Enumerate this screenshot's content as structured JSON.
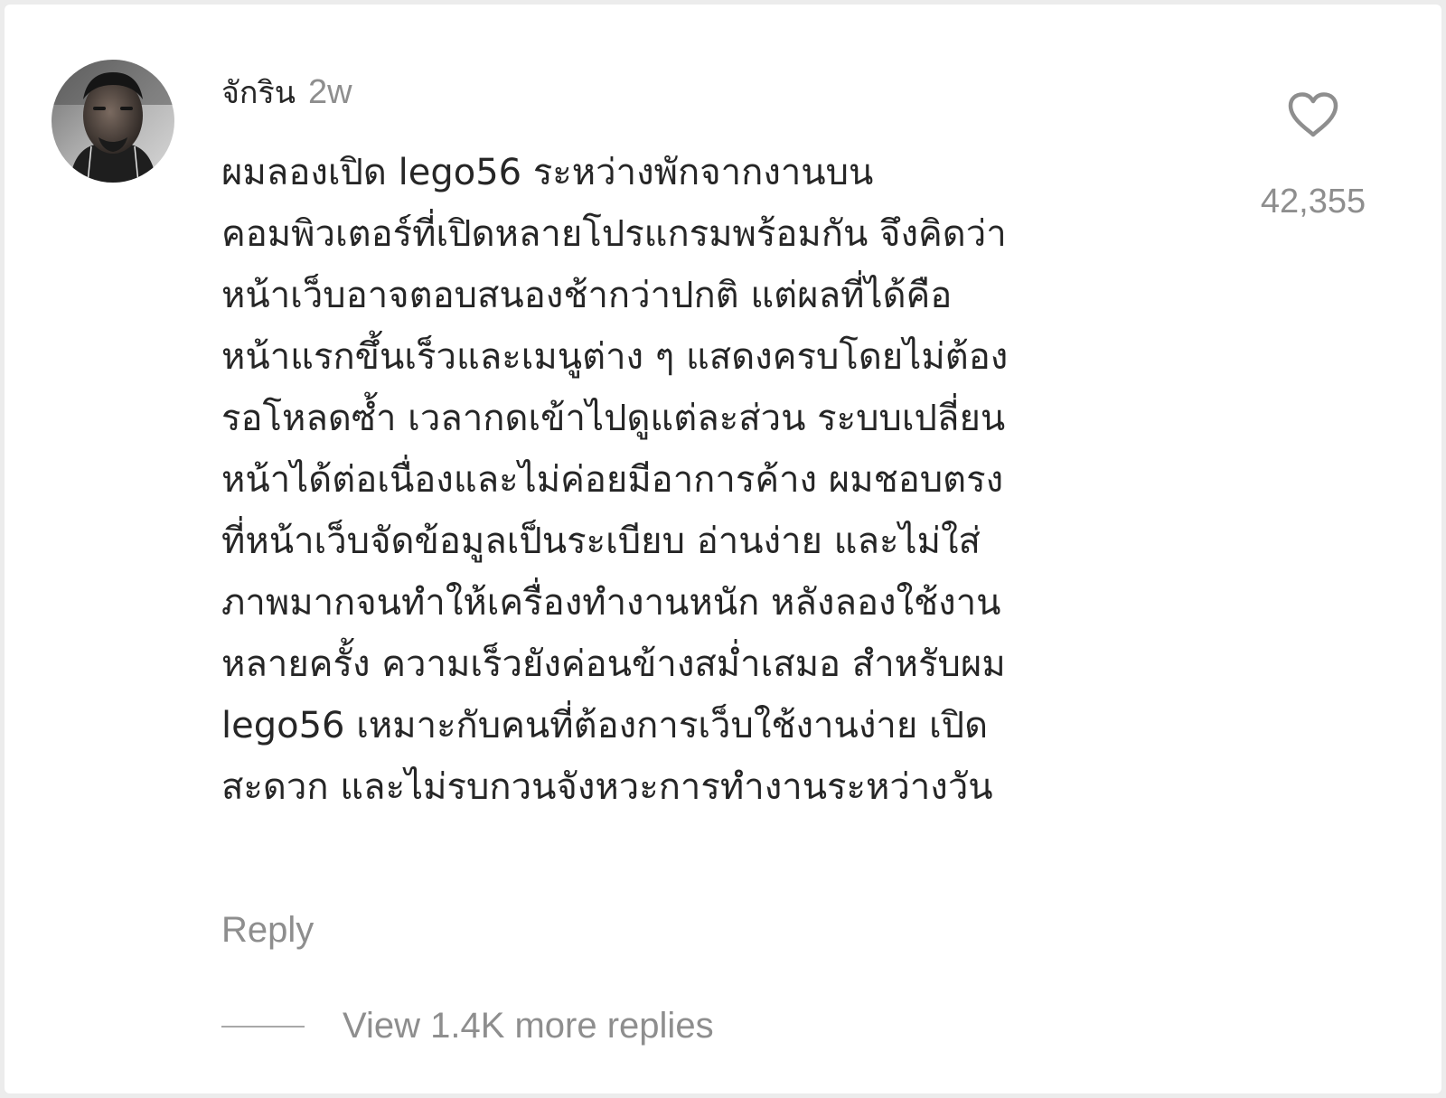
{
  "comment": {
    "username": "จักริน",
    "timestamp": "2w",
    "text": "ผมลองเปิด lego56 ระหว่างพักจากงานบน\nคอมพิวเตอร์ที่เปิดหลายโปรแกรมพร้อมกัน จึงคิดว่า\nหน้าเว็บอาจตอบสนองช้ากว่าปกติ แต่ผลที่ได้คือ\nหน้าแรกขึ้นเร็วและเมนูต่าง ๆ แสดงครบโดยไม่ต้อง\nรอโหลดซ้ำ เวลากดเข้าไปดูแต่ละส่วน ระบบเปลี่ยน\nหน้าได้ต่อเนื่องและไม่ค่อยมีอาการค้าง ผมชอบตรง\nที่หน้าเว็บจัดข้อมูลเป็นระเบียบ อ่านง่าย และไม่ใส่\nภาพมากจนทำให้เครื่องทำงานหนัก หลังลองใช้งาน\nหลายครั้ง ความเร็วยังค่อนข้างสม่ำเสมอ สำหรับผม\nlego56 เหมาะกับคนที่ต้องการเว็บใช้งานง่าย เปิด\nสะดวก และไม่รบกวนจังหวะการทำงานระหว่างวัน",
    "like_count": "42,355",
    "reply_label": "Reply",
    "view_replies_label": "View 1.4K more replies"
  },
  "icons": {
    "like": "heart-outline-icon",
    "avatar": "user-avatar-photo"
  },
  "colors": {
    "background": "#ffffff",
    "primary_text": "#262626",
    "secondary_text": "#8e8e8e",
    "icon": "#8e8e8e"
  }
}
